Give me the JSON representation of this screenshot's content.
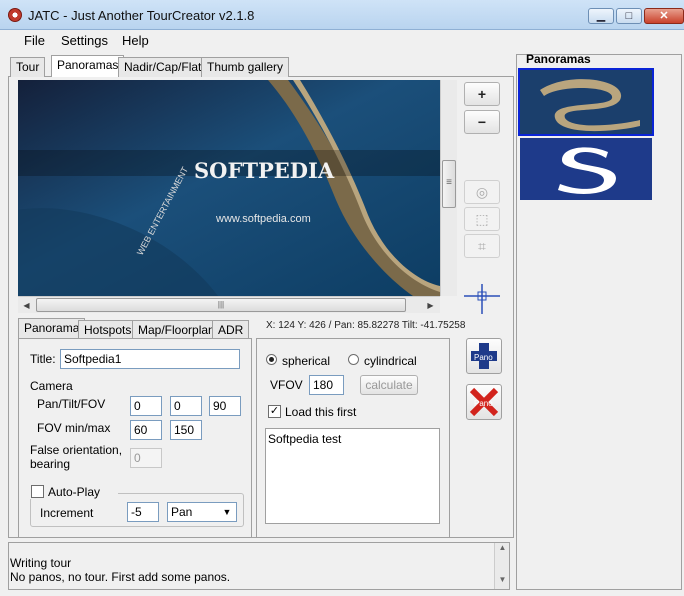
{
  "window": {
    "title": "JATC - Just Another TourCreator v2.1.8",
    "minimize": "▁",
    "maximize": "□",
    "close": "✕"
  },
  "menu": [
    "File",
    "Settings",
    "Help"
  ],
  "main_tabs": [
    "Tour",
    "Panoramas",
    "Nadir/Cap/Flat",
    "Thumb gallery"
  ],
  "preview": {
    "watermark": "SOFTPEDIA",
    "url": "www.softpedia.com",
    "side_text": "WEB  ENTERTAINMENT"
  },
  "scroll": {
    "grip": "≡",
    "hgrip": "|||",
    "up": "▲",
    "down": "▼",
    "left": "◀",
    "right": "▶"
  },
  "tools": {
    "zoom_in": "+",
    "zoom_out": "−",
    "center": "◎",
    "select": "⬚",
    "polygon": "⌗"
  },
  "sub_tabs": [
    "Panorama",
    "Hotspots",
    "Map/Floorplan",
    "ADR"
  ],
  "coords": "X: 124 Y: 426 / Pan: 85.82278 Tilt: -41.75258",
  "form": {
    "title_label": "Title:",
    "title_value": "Softpedia1",
    "camera_label": "Camera",
    "pan_tilt_fov_label": "Pan/Tilt/FOV",
    "pan": "0",
    "tilt": "0",
    "fov": "90",
    "fov_minmax_label": "FOV min/max",
    "fov_min": "60",
    "fov_max": "150",
    "false_orientation_label": "False orientation,",
    "bearing_label": "bearing",
    "bearing_value": "0",
    "autoplay_label": "Auto-Play",
    "increment_label": "Increment",
    "increment_value": "-5",
    "mode_value": "Pan",
    "spherical_label": "spherical",
    "cylindrical_label": "cylindrical",
    "vfov_label": "VFOV",
    "vfov_value": "180",
    "calculate_label": "calculate",
    "load_first_label": "Load this first",
    "load_first_check": "✓",
    "description": "Softpedia test"
  },
  "pano_buttons": {
    "add_label": "Pano",
    "remove_label": "Pano"
  },
  "status": {
    "heading": "Writing tour",
    "message": "No panos, no tour. First add some panos."
  },
  "right_panel": {
    "title": "Panoramas"
  },
  "colors": {
    "selection": "#0a24d6",
    "accent": "#1e3a8a",
    "remove": "#d2231c"
  }
}
